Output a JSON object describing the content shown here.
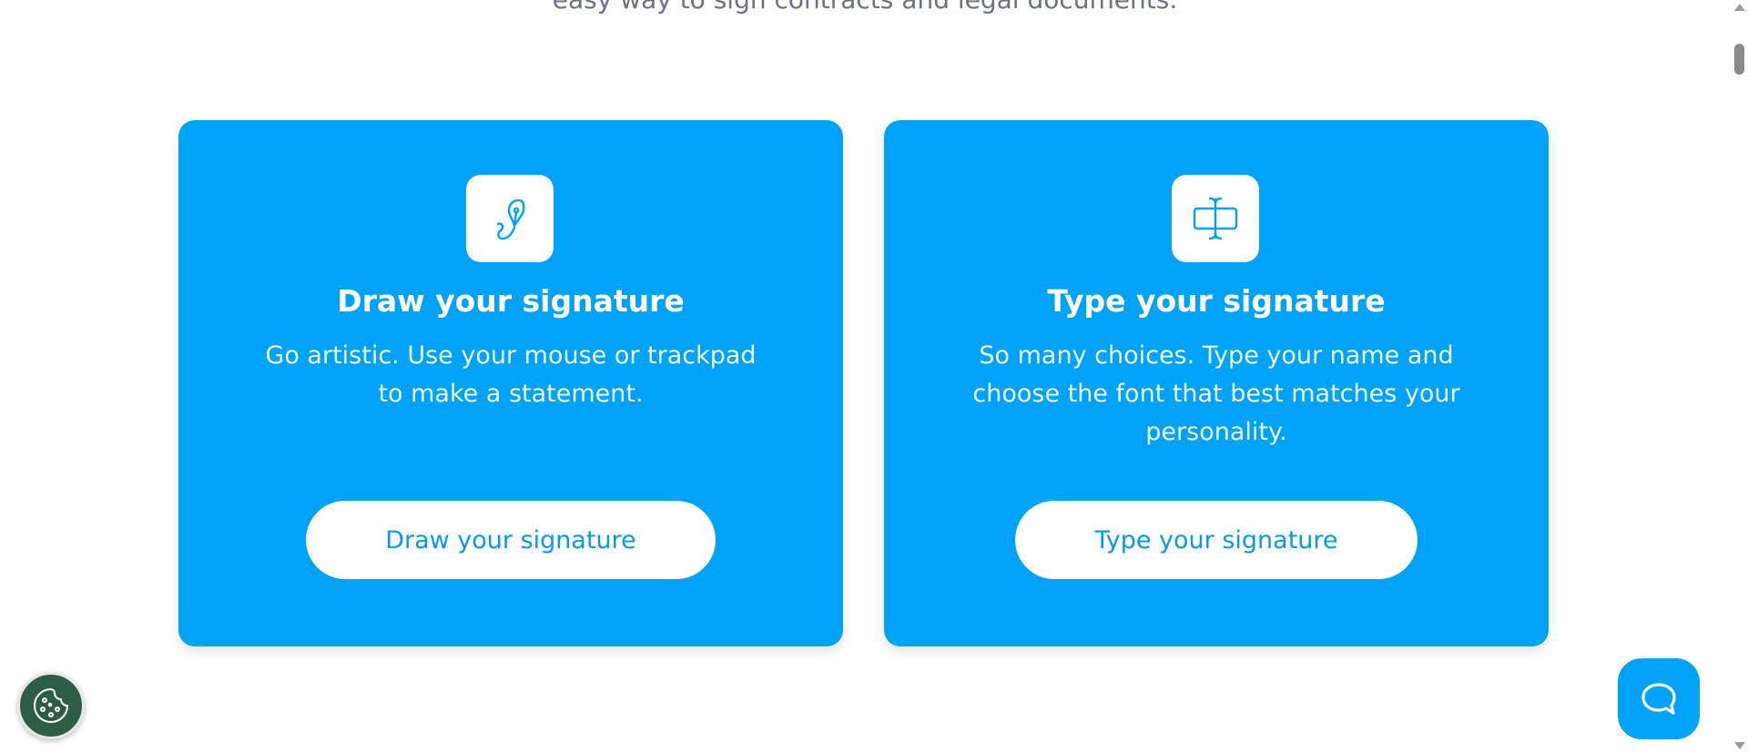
{
  "header": {
    "subtitle_fragment": "easy way to sign contracts and legal documents."
  },
  "cards": [
    {
      "icon": "draw-pen-icon",
      "title": "Draw your signature",
      "description": "Go artistic. Use your mouse or trackpad to make a statement.",
      "button_label": "Draw your signature"
    },
    {
      "icon": "text-cursor-icon",
      "title": "Type your signature",
      "description": "So many choices. Type your name and choose the font that best matches your personality.",
      "button_label": "Type your signature"
    }
  ],
  "widgets": {
    "cookie_icon": "cookie-icon",
    "chat_icon": "chat-bubble-icon"
  },
  "colors": {
    "card_background": "#00a2f8",
    "button_text": "#0a98e8",
    "cookie_background": "#2d5e44"
  }
}
